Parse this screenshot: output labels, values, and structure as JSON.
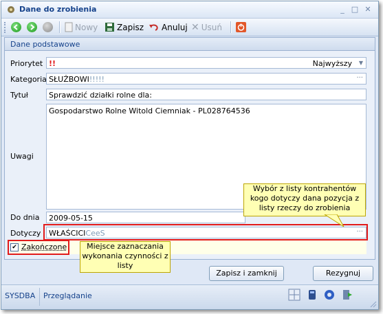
{
  "window": {
    "title": "Dane do zrobienia",
    "buttons": {
      "minimize": "_",
      "maximize": "□",
      "close": "✕"
    }
  },
  "toolbar": {
    "new_label": "Nowy",
    "save_label": "Zapisz",
    "cancel_label": "Anuluj",
    "delete_label": "Usuń"
  },
  "group": {
    "title": "Dane podstawowe"
  },
  "form": {
    "priority": {
      "label": "Priorytet",
      "marker": "!!",
      "value": "Najwyższy"
    },
    "category": {
      "label": "Kategoria",
      "value": "SŁUŻBOWI",
      "suffix": "!!!!!"
    },
    "title": {
      "label": "Tytuł",
      "value": "Sprawdzić działki rolne dla:"
    },
    "notes": {
      "label": "Uwagi",
      "value": "Gospodarstwo Rolne Witold Ciemniak - PL028764536"
    },
    "due_date": {
      "label": "Do dnia",
      "value": "2009-05-15"
    },
    "related": {
      "label": "Dotyczy",
      "value": "WŁAŚCICI",
      "suffix": "CeeS"
    },
    "completed": {
      "label": "Zakończone",
      "checked": true
    }
  },
  "tooltips": {
    "related": "Wybór z listy kontrahentów kogo dotyczy dana pozycja z listy rzeczy do zrobienia",
    "completed": "Miejsce zaznaczania wykonania czynności z listy"
  },
  "actions": {
    "save_close": "Zapisz i zamknij",
    "resign": "Rezygnuj"
  },
  "status": {
    "user": "SYSDBA",
    "mode": "Przeglądanie"
  },
  "colors": {
    "accent": "#15428b",
    "highlight": "#e21a1a",
    "tooltip": "#ffffb4"
  }
}
